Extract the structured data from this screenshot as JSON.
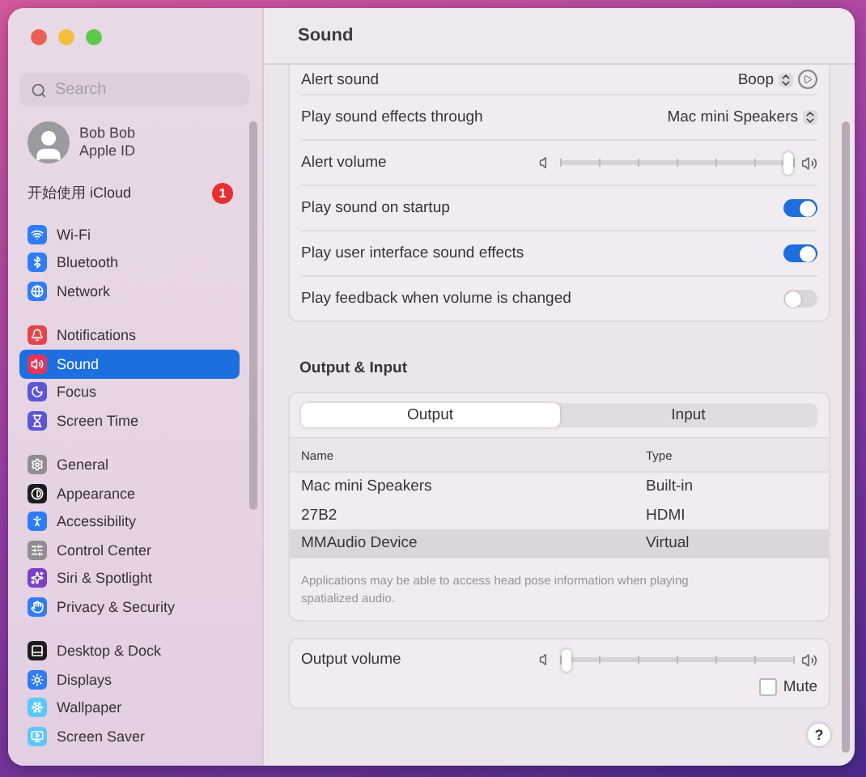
{
  "window": {
    "title": "Sound"
  },
  "sidebar": {
    "search": {
      "placeholder": "Search"
    },
    "account": {
      "name": "Bob Bob",
      "subtitle": "Apple ID"
    },
    "icloud": {
      "label": "开始使用 iCloud",
      "badge": "1"
    },
    "groups": [
      [
        {
          "label": "Wi-Fi",
          "selected": false,
          "color": "#2f7cf6"
        },
        {
          "label": "Bluetooth",
          "selected": false,
          "color": "#2f7cf6"
        },
        {
          "label": "Network",
          "selected": false,
          "color": "#2f7cf6"
        }
      ],
      [
        {
          "label": "Notifications",
          "selected": false,
          "color": "#e5454a"
        },
        {
          "label": "Sound",
          "selected": true,
          "color": "#e5345a"
        },
        {
          "label": "Focus",
          "selected": false,
          "color": "#5b56d6"
        },
        {
          "label": "Screen Time",
          "selected": false,
          "color": "#5b56d6"
        }
      ],
      [
        {
          "label": "General",
          "selected": false,
          "color": "#8e8e93"
        },
        {
          "label": "Appearance",
          "selected": false,
          "color": "#1c1c1e"
        },
        {
          "label": "Accessibility",
          "selected": false,
          "color": "#2f7cf6"
        },
        {
          "label": "Control Center",
          "selected": false,
          "color": "#8e8e93"
        },
        {
          "label": "Siri & Spotlight",
          "selected": false,
          "color": "#7a3fc4"
        },
        {
          "label": "Privacy & Security",
          "selected": false,
          "color": "#2f7cf6"
        }
      ],
      [
        {
          "label": "Desktop & Dock",
          "selected": false,
          "color": "#1c1c1e"
        },
        {
          "label": "Displays",
          "selected": false,
          "color": "#2f7cf6"
        },
        {
          "label": "Wallpaper",
          "selected": false,
          "color": "#5ac8fa"
        },
        {
          "label": "Screen Saver",
          "selected": false,
          "color": "#5ac8fa"
        }
      ]
    ]
  },
  "settings": [
    {
      "kind": "popup",
      "label": "Alert sound",
      "value": "Boop",
      "play": true
    },
    {
      "kind": "popup",
      "label": "Play sound effects through",
      "value": "Mac mini Speakers",
      "play": false
    },
    {
      "kind": "slider",
      "label": "Alert volume",
      "level": 0.97
    },
    {
      "kind": "toggle",
      "label": "Play sound on startup",
      "on": true
    },
    {
      "kind": "toggle",
      "label": "Play user interface sound effects",
      "on": true
    },
    {
      "kind": "toggle",
      "label": "Play feedback when volume is changed",
      "on": false
    }
  ],
  "output_input": {
    "title": "Output & Input",
    "tabs": [
      {
        "label": "Output",
        "selected": true
      },
      {
        "label": "Input",
        "selected": false
      }
    ],
    "columns": [
      "Name",
      "Type"
    ],
    "rows": [
      {
        "name": "Mac mini Speakers",
        "type": "Built-in",
        "selected": false
      },
      {
        "name": "27B2",
        "type": "HDMI",
        "selected": false
      },
      {
        "name": "MMAudio Device",
        "type": "Virtual",
        "selected": true
      }
    ],
    "note": "Applications may be able to access head pose information when playing spatialized audio."
  },
  "output_volume": {
    "label": "Output volume",
    "level": 0.03,
    "mute": {
      "label": "Mute",
      "checked": false
    }
  },
  "help": "?"
}
